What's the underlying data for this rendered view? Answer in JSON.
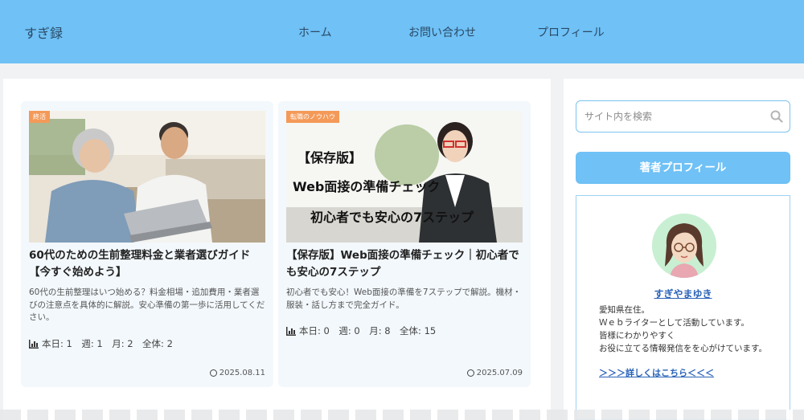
{
  "site": {
    "title": "すぎ録"
  },
  "nav": {
    "items": [
      "ホーム",
      "お問い合わせ",
      "プロフィール"
    ]
  },
  "colors": {
    "header": "#6fc1f6",
    "category_badge": "#f49a59",
    "link": "#2a63b8"
  },
  "posts": [
    {
      "category": "終活",
      "title": "60代のための生前整理料金と業者選びガイド【今すぐ始めよう】",
      "excerpt": "60代の生前整理はいつ始める？料金相場・追加費用・業者選びの注意点を具体的に解説。安心準備の第一歩に活用してください。",
      "stats": "本日: 1　週: 1　月: 2　全体: 2",
      "date": "2025.08.11",
      "thumbnail_text": []
    },
    {
      "category": "転職のノウハウ",
      "title": "【保存版】Web面接の準備チェック｜初心者でも安心の7ステップ",
      "excerpt": "初心者でも安心！Web面接の準備を7ステップで解説。機材・服装・話し方まで完全ガイド。",
      "stats": "本日: 0　週: 0　月: 8　全体: 15",
      "date": "2025.07.09",
      "thumbnail_text": [
        "【保存版】",
        "Web面接の準備チェック",
        "初心者でも安心の7ステップ"
      ]
    }
  ],
  "sidebar": {
    "search_placeholder": "サイト内を検索",
    "profile_heading": "著者プロフィール",
    "author_name": "すぎやまゆき",
    "bio": [
      "愛知県在住。",
      "Ｗｅｂライターとして活動しています。",
      "皆様にわかりやすく",
      "お役に立てる情報発信をを心がけています。"
    ],
    "more_link": "＞＞＞詳しくはこちら＜＜＜"
  },
  "icons": {
    "stats": "bar-chart-icon",
    "date": "clock-icon",
    "search": "search-icon"
  }
}
